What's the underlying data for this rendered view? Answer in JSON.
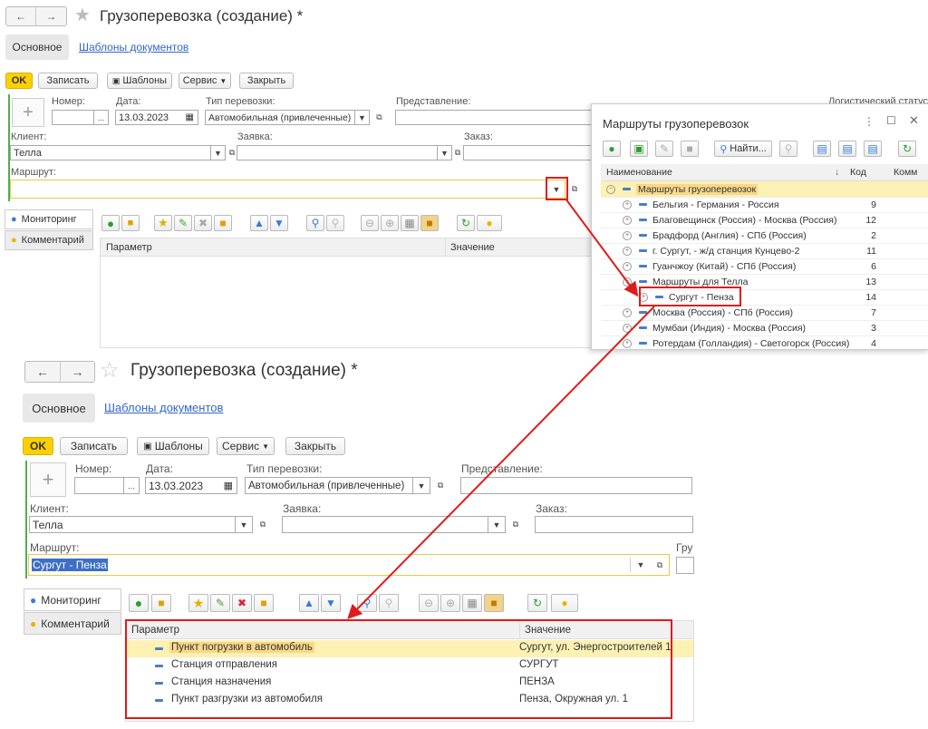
{
  "window": {
    "title": "Грузоперевозка (создание) *",
    "tab_main": "Основное",
    "tab_templates": "Шаблоны документов"
  },
  "toolbar": {
    "ok": "OK",
    "save": "Записать",
    "templates": "Шаблоны",
    "service": "Сервис",
    "close": "Закрыть"
  },
  "form_top": {
    "number_label": "Номер:",
    "date_label": "Дата:",
    "date_value": "13.03.2023",
    "transport_label": "Тип перевозки:",
    "transport_value": "Автомобильная (привлеченные)",
    "view_label": "Представление:",
    "logistic_label": "Логистический статус:",
    "client_label": "Клиент:",
    "client_value": "Телла",
    "request_label": "Заявка:",
    "order_label": "Заказ:",
    "route_label": "Маршрут:",
    "route_value": ""
  },
  "form_bottom": {
    "number_label": "Номер:",
    "date_label": "Дата:",
    "date_value": "13.03.2023",
    "transport_label": "Тип перевозки:",
    "transport_value": "Автомобильная (привлеченные)",
    "view_label": "Представление:",
    "client_label": "Клиент:",
    "client_value": "Телла",
    "request_label": "Заявка:",
    "order_label": "Заказ:",
    "route_label": "Маршрут:",
    "route_value": "Сургут - Пенза",
    "extra_label": "Гру"
  },
  "side_tabs": {
    "monitoring": "Мониторинг",
    "comment": "Комментарий"
  },
  "params_table": {
    "col_param": "Параметр",
    "col_value": "Значение",
    "rows": [
      {
        "param": "Пункт погрузки в автомобиль",
        "value": "Сургут, ул. Энергостроителей 1"
      },
      {
        "param": "Станция отправления",
        "value": "СУРГУТ"
      },
      {
        "param": "Станция назначения",
        "value": "ПЕНЗА"
      },
      {
        "param": "Пункт разгрузки из автомобиля",
        "value": "Пенза, Окружная ул. 1"
      }
    ]
  },
  "routes_popup": {
    "title": "Маршруты грузоперевозок",
    "find": "Найти...",
    "col_name": "Наименование",
    "col_code": "Код",
    "col_comment": "Комм",
    "root": "Маршруты грузоперевозок",
    "items": [
      {
        "name": "Бельгия - Германия - Россия",
        "code": "9"
      },
      {
        "name": "Благовещинск (Россия) - Москва (Россия)",
        "code": "12"
      },
      {
        "name": "Брадфорд (Англия) - СПб (Россия)",
        "code": "2"
      },
      {
        "name": "г. Сургут, - ж/д станция Кунцево-2",
        "code": "11"
      },
      {
        "name": "Гуанчжоу (Китай) - СПб (Россия)",
        "code": "6"
      },
      {
        "name": "Маршруты для Телла",
        "code": "13"
      },
      {
        "name": "Сургут - Пенза",
        "code": "14"
      },
      {
        "name": "Москва (Россия) - СПб (Россия)",
        "code": "7"
      },
      {
        "name": "Мумбаи (Индия) - Москва (Россия)",
        "code": "3"
      },
      {
        "name": "Ротердам (Голландия) - Светогорск (Россия)",
        "code": "4"
      }
    ]
  },
  "colors": {
    "ok_yellow": "#fcd000",
    "highlight": "#fdf1b4",
    "annotation_red": "#e01b1b",
    "link_blue": "#3366cc"
  }
}
